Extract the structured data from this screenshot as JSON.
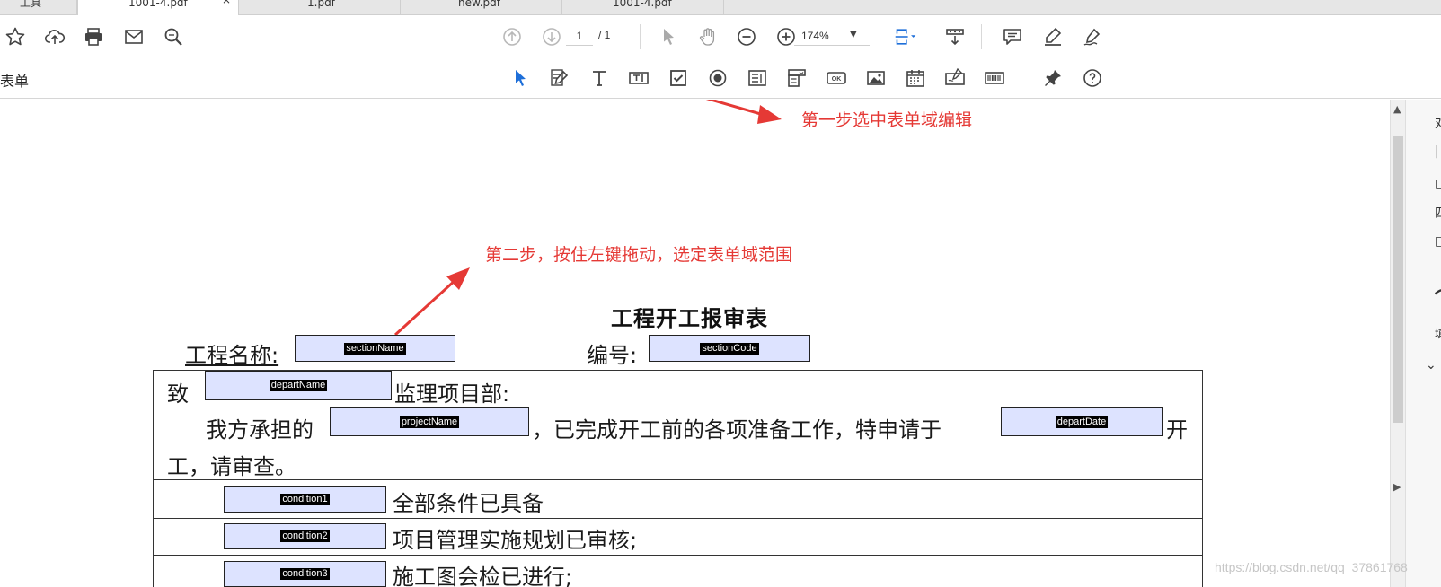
{
  "tabs": [
    {
      "label": "工具"
    },
    {
      "label": "1001-4.pdf"
    },
    {
      "label": "1.pdf"
    },
    {
      "label": "new.pdf"
    },
    {
      "label": "1001-4.pdf"
    }
  ],
  "tab_close_label": "×",
  "toolbar": {
    "page_current": "1",
    "page_total": "/ 1",
    "zoom": "174%"
  },
  "tool_label": "表单",
  "annotations": {
    "step1": "第一步选中表单域编辑",
    "step2": "第二步，按住左键拖动，选定表单域范围",
    "color": "#e53935"
  },
  "document": {
    "title": "工程开工报审表",
    "project_name_label": "工程名称:",
    "code_label": "编号:",
    "to_prefix": "致",
    "to_suffix": "监理项目部:",
    "body_prefix": "我方承担的",
    "body_middle": "，已完成开工前的各项准备工作，特申请于",
    "body_suffix": "开",
    "body_line2": "工，请审查。",
    "cond1_text": "全部条件已具备",
    "cond2_text": "项目管理实施规划已审核;",
    "cond3_text": "施工图会检已进行;"
  },
  "fields": {
    "sectionName": "sectionName",
    "sectionCode": "sectionCode",
    "departName": "departName",
    "projectName": "projectName",
    "departDate": "departDate",
    "condition1": "condition1",
    "condition2": "condition2",
    "condition3": "condition3",
    "fill_color": "#dde3ff"
  },
  "right_pane": {
    "items": [
      "对",
      "|",
      "□",
      "四",
      "□",
      "⌒",
      "填"
    ],
    "chevron": "⌄"
  },
  "watermark": "https://blog.csdn.net/qq_37861768"
}
